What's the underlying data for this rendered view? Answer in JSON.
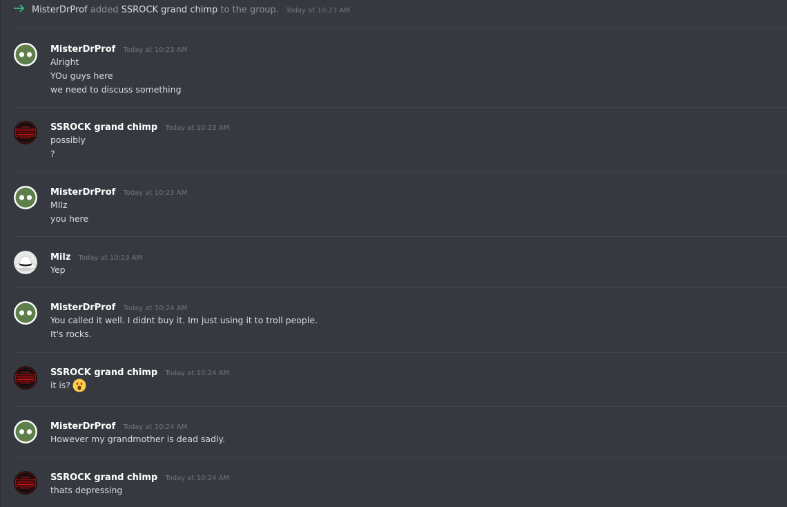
{
  "system": {
    "actor": "MisterDrProf",
    "action": "added",
    "target": "SSROCK grand chimp",
    "suffix": "to the group.",
    "timestamp": "Today at 10:23 AM",
    "arrow_color": "#43b581"
  },
  "colors": {
    "background": "#36393f",
    "divider": "#40444b",
    "author": "#ffffff",
    "text": "#dcddde",
    "timestamp": "#72767d",
    "avatar_green": "#5f7f4a"
  },
  "messages": [
    {
      "author": "MisterDrProf",
      "timestamp": "Today at 10:23 AM",
      "avatar": "green-eyes-avatar",
      "lines": [
        "Alright",
        "YOu guys here",
        "we need to discuss something"
      ]
    },
    {
      "author": "SSROCK grand chimp",
      "timestamp": "Today at 10:23 AM",
      "avatar": "red-logo-avatar",
      "lines": [
        "possibly",
        "?"
      ]
    },
    {
      "author": "MisterDrProf",
      "timestamp": "Today at 10:23 AM",
      "avatar": "green-eyes-avatar",
      "lines": [
        "MIlz",
        "you here"
      ]
    },
    {
      "author": "Milz",
      "timestamp": "Today at 10:23 AM",
      "avatar": "white-hat-avatar",
      "lines": [
        "Yep"
      ]
    },
    {
      "author": "MisterDrProf",
      "timestamp": "Today at 10:24 AM",
      "avatar": "green-eyes-avatar",
      "lines": [
        "You called it well. I didnt buy it. Im just using it to troll people.",
        "It's rocks."
      ]
    },
    {
      "author": "SSROCK grand chimp",
      "timestamp": "Today at 10:24 AM",
      "avatar": "red-logo-avatar",
      "lines": [
        "it is?"
      ],
      "emoji": "open-mouth-emoji"
    },
    {
      "author": "MisterDrProf",
      "timestamp": "Today at 10:24 AM",
      "avatar": "green-eyes-avatar",
      "lines": [
        "However my grandmother is dead sadly."
      ]
    },
    {
      "author": "SSROCK grand chimp",
      "timestamp": "Today at 10:24 AM",
      "avatar": "red-logo-avatar",
      "lines": [
        "thats depressing"
      ]
    }
  ]
}
